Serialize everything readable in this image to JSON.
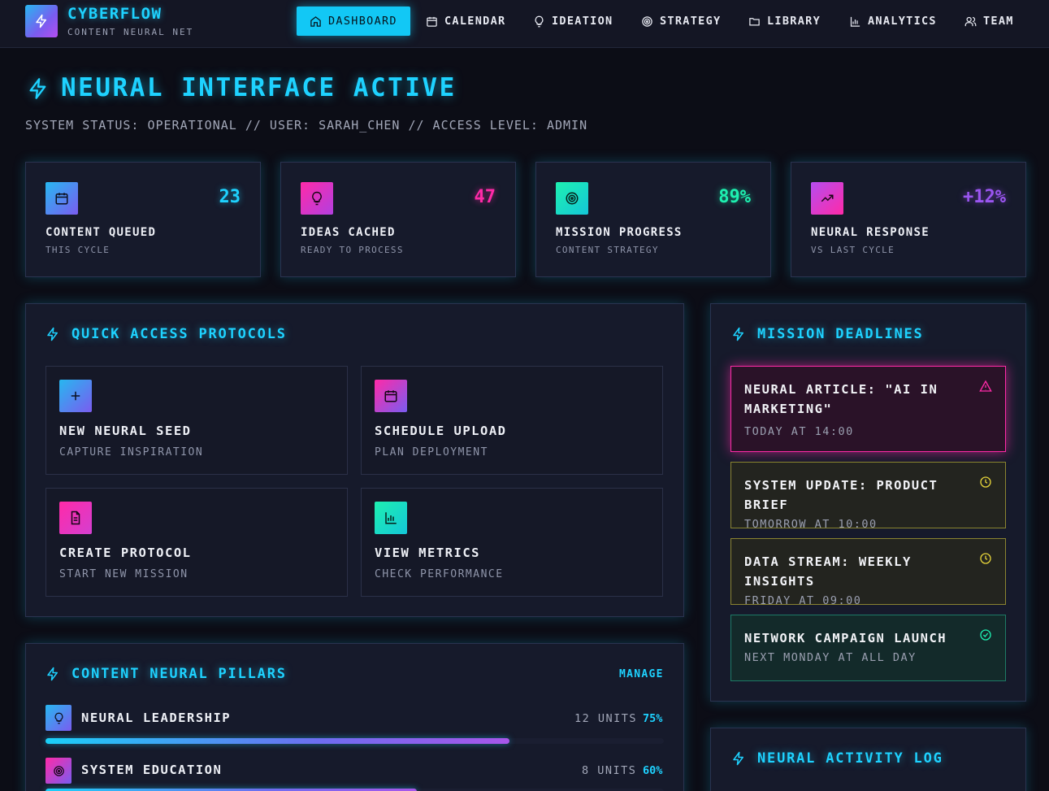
{
  "brand": {
    "name": "CYBERFLOW",
    "subtitle": "CONTENT NEURAL NET"
  },
  "nav": [
    {
      "label": "DASHBOARD",
      "icon": "home-icon",
      "active": true
    },
    {
      "label": "CALENDAR",
      "icon": "calendar-icon",
      "active": false
    },
    {
      "label": "IDEATION",
      "icon": "lightbulb-icon",
      "active": false
    },
    {
      "label": "STRATEGY",
      "icon": "target-icon",
      "active": false
    },
    {
      "label": "LIBRARY",
      "icon": "folder-icon",
      "active": false
    },
    {
      "label": "ANALYTICS",
      "icon": "bar-chart-icon",
      "active": false
    },
    {
      "label": "TEAM",
      "icon": "users-icon",
      "active": false
    }
  ],
  "header": {
    "title": "NEURAL INTERFACE ACTIVE",
    "status": "SYSTEM STATUS: OPERATIONAL // USER: SARAH_CHEN // ACCESS LEVEL: ADMIN"
  },
  "stats": [
    {
      "value": "23",
      "label": "CONTENT QUEUED",
      "sub": "THIS CYCLE",
      "icon": "calendar-icon",
      "color": "#1ed2ff"
    },
    {
      "value": "47",
      "label": "IDEAS CACHED",
      "sub": "READY TO PROCESS",
      "icon": "lightbulb-icon",
      "color": "#ff2aa8"
    },
    {
      "value": "89%",
      "label": "MISSION PROGRESS",
      "sub": "CONTENT STRATEGY",
      "icon": "target-icon",
      "color": "#1ef0b0"
    },
    {
      "value": "+12%",
      "label": "NEURAL RESPONSE",
      "sub": "VS LAST CYCLE",
      "icon": "trending-up-icon",
      "color": "#9a55f0"
    }
  ],
  "quick_access": {
    "title": "QUICK ACCESS PROTOCOLS",
    "items": [
      {
        "label": "NEW NEURAL SEED",
        "sub": "CAPTURE INSPIRATION",
        "icon": "plus-icon"
      },
      {
        "label": "SCHEDULE UPLOAD",
        "sub": "PLAN DEPLOYMENT",
        "icon": "calendar-icon"
      },
      {
        "label": "CREATE PROTOCOL",
        "sub": "START NEW MISSION",
        "icon": "document-icon"
      },
      {
        "label": "VIEW METRICS",
        "sub": "CHECK PERFORMANCE",
        "icon": "bar-chart-icon"
      }
    ]
  },
  "deadlines": {
    "title": "MISSION DEADLINES",
    "items": [
      {
        "title": "NEURAL ARTICLE: \"AI IN MARKETING\"",
        "time": "TODAY AT 14:00",
        "status": "urgent",
        "icon": "warning-icon"
      },
      {
        "title": "SYSTEM UPDATE: PRODUCT BRIEF",
        "time": "TOMORROW AT 10:00",
        "status": "pending",
        "icon": "clock-icon"
      },
      {
        "title": "DATA STREAM: WEEKLY INSIGHTS",
        "time": "FRIDAY AT 09:00",
        "status": "pending",
        "icon": "clock-icon"
      },
      {
        "title": "NETWORK CAMPAIGN LAUNCH",
        "time": "NEXT MONDAY AT ALL DAY",
        "status": "done",
        "icon": "check-circle-icon"
      }
    ]
  },
  "pillars": {
    "title": "CONTENT NEURAL PILLARS",
    "manage_label": "MANAGE",
    "items": [
      {
        "name": "NEURAL LEADERSHIP",
        "units": "12 UNITS",
        "pct": "75%",
        "progress": 0.75,
        "icon": "lightbulb-icon"
      },
      {
        "name": "SYSTEM EDUCATION",
        "units": "8 UNITS",
        "pct": "60%",
        "progress": 0.6,
        "icon": "target-icon"
      }
    ]
  },
  "activity": {
    "title": "NEURAL ACTIVITY LOG"
  },
  "colors": {
    "accent": "#1ed2ff",
    "magenta": "#ff2aa8",
    "green": "#1ef0b0",
    "purple": "#9a55f0",
    "yellow": "#e6d43a"
  }
}
